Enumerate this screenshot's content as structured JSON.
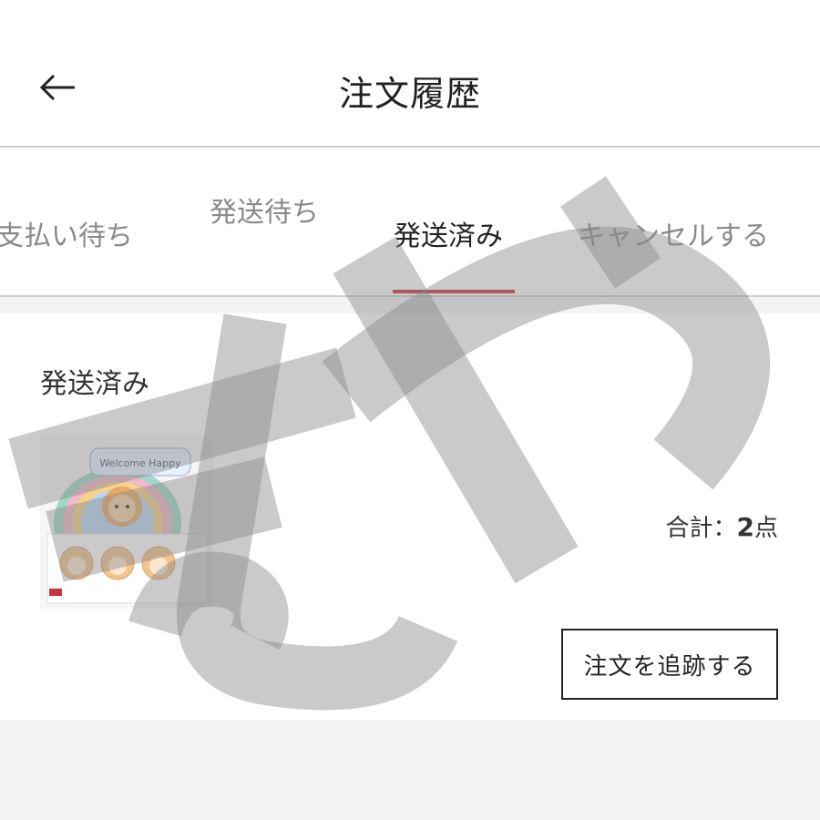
{
  "header": {
    "back_icon": "arrow-left-icon",
    "title": "注文履歴"
  },
  "tabs": [
    {
      "label": "支払い待ち",
      "active": false
    },
    {
      "label": "発送待ち",
      "active": false
    },
    {
      "label": "発送済み",
      "active": true
    },
    {
      "label": "キャンセルする",
      "active": false
    }
  ],
  "accent_color": "#c8323a",
  "order": {
    "status": "発送済み",
    "thumbnail_text": "Welcome Happy",
    "total_label": "合計：",
    "total_count": "2",
    "total_unit": "点",
    "track_button_label": "注文を追跡する"
  },
  "watermark": {
    "text": "まや"
  }
}
